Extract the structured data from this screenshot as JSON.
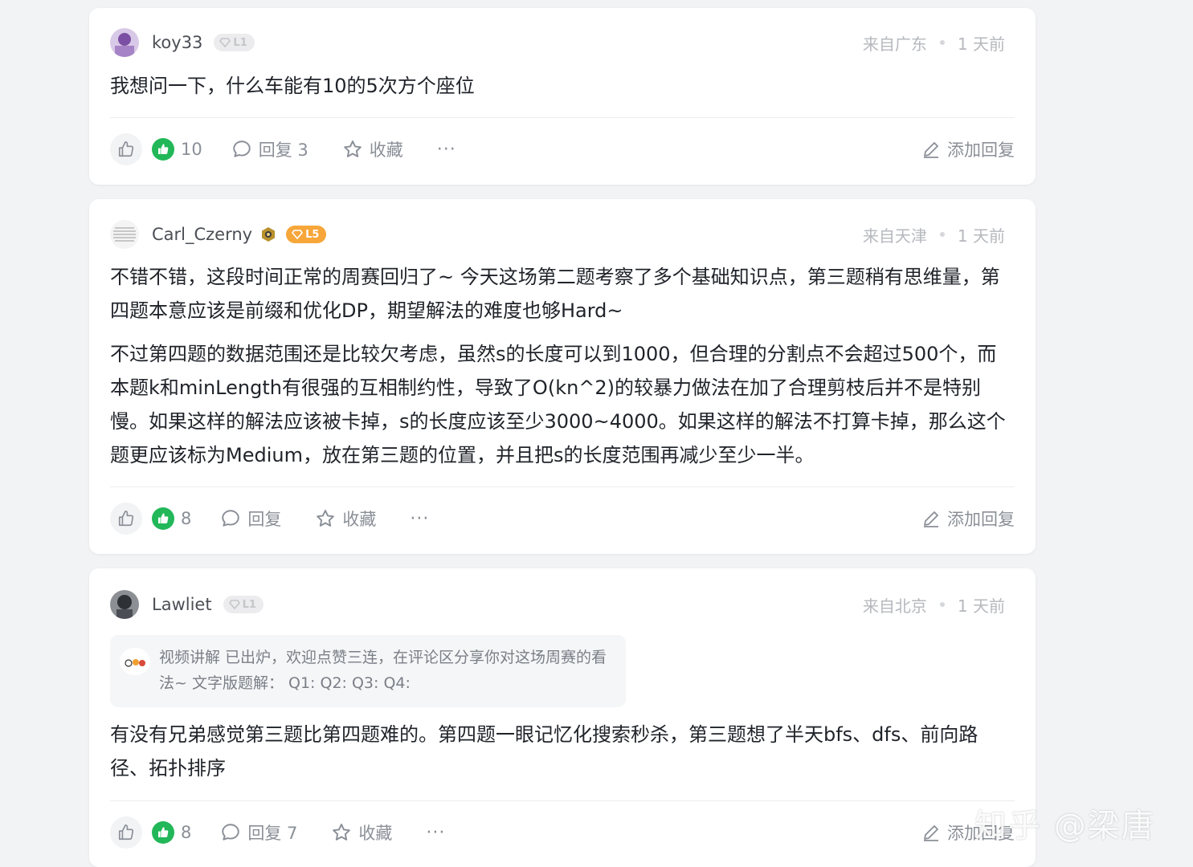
{
  "comments": [
    {
      "username": "koy33",
      "level": "L1",
      "location": "来自广东",
      "time": "1 天前",
      "paragraphs": [
        "我想问一下，什么车能有10的5次方个座位"
      ],
      "likes": "10",
      "reply_label": "回复 3",
      "collect_label": "收藏",
      "more_label": "···",
      "add_reply_label": "添加回复"
    },
    {
      "username": "Carl_Czerny",
      "level": "L5",
      "location": "来自天津",
      "time": "1 天前",
      "paragraphs": [
        "不错不错，这段时间正常的周赛回归了~ 今天这场第二题考察了多个基础知识点，第三题稍有思维量，第四题本意应该是前缀和优化DP，期望解法的难度也够Hard~",
        "不过第四题的数据范围还是比较欠考虑，虽然s的长度可以到1000，但合理的分割点不会超过500个，而本题k和minLength有很强的互相制约性，导致了O(kn^2)的较暴力做法在加了合理剪枝后并不是特别慢。如果这样的解法应该被卡掉，s的长度应该至少3000~4000。如果这样的解法不打算卡掉，那么这个题更应该标为Medium，放在第三题的位置，并且把s的长度范围再减少至少一半。"
      ],
      "likes": "8",
      "reply_label": "回复",
      "collect_label": "收藏",
      "more_label": "···",
      "add_reply_label": "添加回复"
    },
    {
      "username": "Lawliet",
      "level": "L1",
      "location": "来自北京",
      "time": "1 天前",
      "quote": "视频讲解 已出炉，欢迎点赞三连，在评论区分享你对这场周赛的看法~ 文字版题解： Q1: Q2: Q3: Q4:",
      "paragraphs": [
        "有没有兄弟感觉第三题比第四题难的。第四题一眼记忆化搜索秒杀，第三题想了半天bfs、dfs、前向路径、拓扑排序"
      ],
      "likes": "8",
      "reply_label": "回复 7",
      "collect_label": "收藏",
      "more_label": "···",
      "add_reply_label": "添加回复"
    }
  ],
  "watermark": "知乎 @梁唐",
  "colors": {
    "like_green": "#22b758",
    "level_orange": "#f7a63a"
  },
  "icons": [
    "thumb-up-icon",
    "comment-bubble-icon",
    "star-icon",
    "pencil-icon",
    "diamond-icon"
  ]
}
